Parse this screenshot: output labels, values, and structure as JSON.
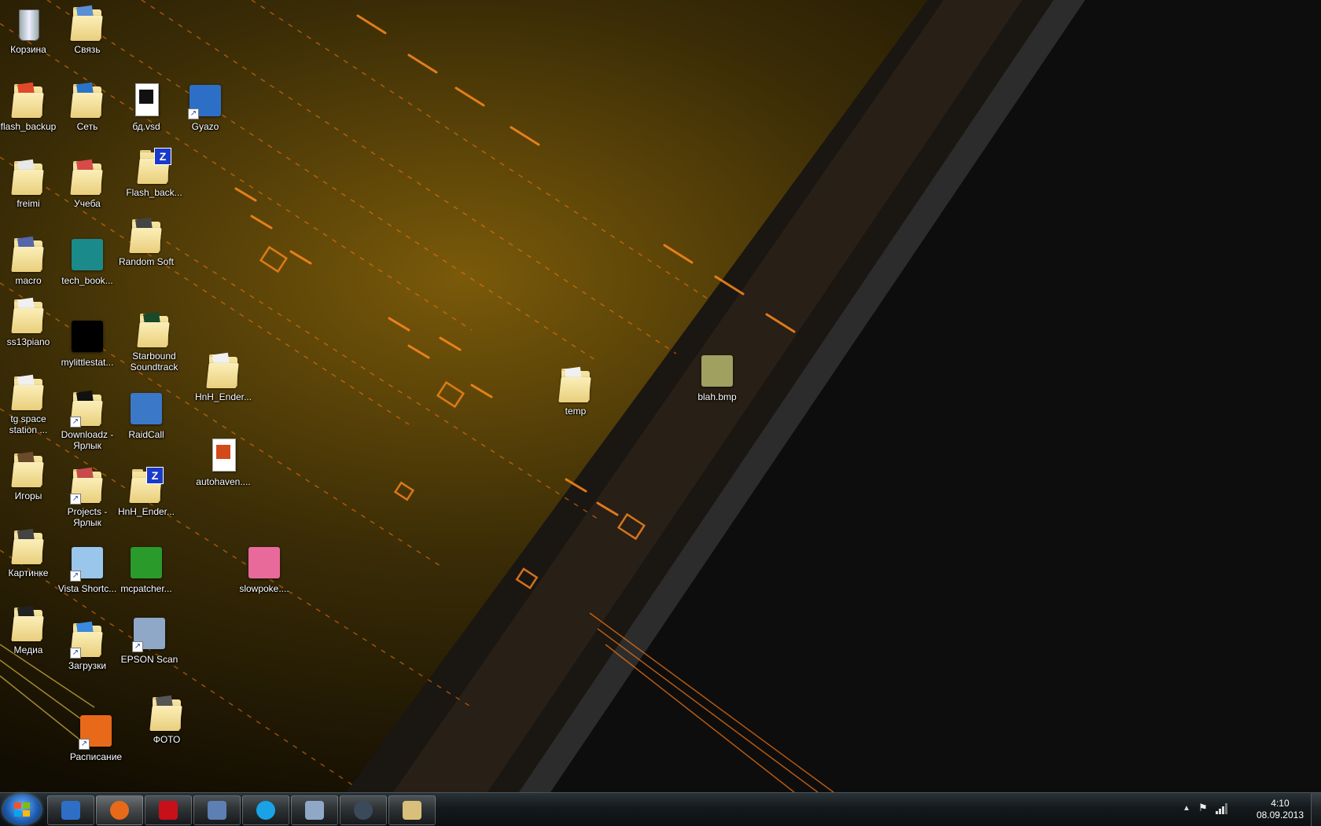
{
  "desktop": {
    "icons": [
      {
        "label": "Корзина"
      },
      {
        "label": "Связь"
      },
      {
        "label": "flash_backup"
      },
      {
        "label": "Сеть"
      },
      {
        "label": "бд.vsd"
      },
      {
        "label": "Gyazo"
      },
      {
        "label": "freimi"
      },
      {
        "label": "Учеба"
      },
      {
        "label": "Flash_back..."
      },
      {
        "label": "macro"
      },
      {
        "label": "tech_book..."
      },
      {
        "label": "Random Soft"
      },
      {
        "label": "ss13piano"
      },
      {
        "label": "mylittlestat..."
      },
      {
        "label": "Starbound Soundtrack"
      },
      {
        "label": "tg space station ..."
      },
      {
        "label": "Downloadz - Ярлык"
      },
      {
        "label": "RaidCall"
      },
      {
        "label": "HnH_Ender..."
      },
      {
        "label": "temp"
      },
      {
        "label": "blah.bmp"
      },
      {
        "label": "autohaven...."
      },
      {
        "label": "Игоры"
      },
      {
        "label": "Projects - Ярлык"
      },
      {
        "label": "HnH_Ender..."
      },
      {
        "label": "Картинке"
      },
      {
        "label": "Vista Shortc..."
      },
      {
        "label": "mcpatcher..."
      },
      {
        "label": "slowpoke...."
      },
      {
        "label": "Медиа"
      },
      {
        "label": "Загрузки"
      },
      {
        "label": "EPSON Scan"
      },
      {
        "label": "ФОТО"
      },
      {
        "label": "Расписание"
      }
    ]
  },
  "taskbar": {
    "apps": [
      {
        "icon": "gyazo-icon",
        "color": "#2d6fc7"
      },
      {
        "icon": "firefox-icon",
        "color": "#e8691a"
      },
      {
        "icon": "adobe-reader-icon",
        "color": "#c8101a"
      },
      {
        "icon": "network-globe-icon",
        "color": "#5d7fb2"
      },
      {
        "icon": "skype-icon",
        "color": "#1aa2e6"
      },
      {
        "icon": "epson-scan-icon",
        "color": "#8fa8c8"
      },
      {
        "icon": "steam-icon",
        "color": "#3a4a5a"
      },
      {
        "icon": "paint-palette-icon",
        "color": "#d9c07a"
      }
    ],
    "clock": {
      "time": "4:10",
      "date": "08.09.2013"
    }
  },
  "colors": {
    "accent": "#ff8a1c",
    "taskbar": "#14191c"
  }
}
